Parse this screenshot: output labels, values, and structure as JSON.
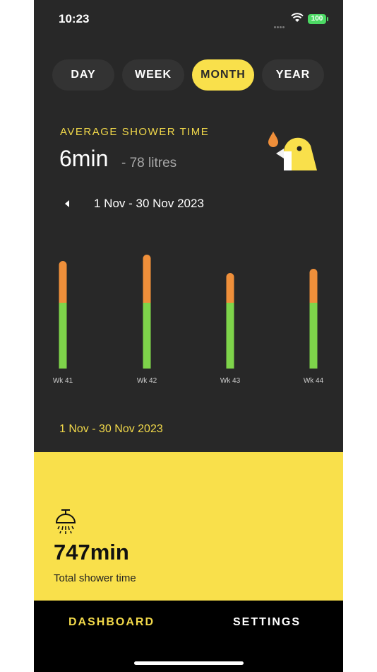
{
  "status_bar": {
    "time": "10:23",
    "battery": "100"
  },
  "tabs": [
    {
      "label": "DAY",
      "active": false
    },
    {
      "label": "WEEK",
      "active": false
    },
    {
      "label": "MONTH",
      "active": true
    },
    {
      "label": "YEAR",
      "active": false
    }
  ],
  "summary": {
    "label": "AVERAGE SHOWER TIME",
    "value": "6min",
    "subtext": "- 78 litres"
  },
  "date_range": "1 Nov - 30 Nov 2023",
  "chart_data": {
    "type": "bar",
    "categories": [
      "Wk 41",
      "Wk 42",
      "Wk 43",
      "Wk 44"
    ],
    "series": [
      {
        "values": [
          93,
          93,
          93,
          93
        ],
        "color": "#7ed44a"
      },
      {
        "values": [
          59,
          68,
          42,
          48
        ],
        "color": "#ef8f3a"
      }
    ],
    "stacked": true
  },
  "footer_date": "1 Nov - 30 Nov 2023",
  "total": {
    "value": "747min",
    "label": "Total shower time"
  },
  "nav": {
    "dashboard": "DASHBOARD",
    "settings": "SETTINGS"
  },
  "colors": {
    "accent": "#f9e04b",
    "background": "#282828",
    "green": "#7ed44a",
    "orange": "#ef8f3a"
  },
  "icons": [
    "wifi-icon",
    "battery-icon",
    "bird-icon",
    "water-drop-icon",
    "chevron-left-icon",
    "shower-icon"
  ]
}
